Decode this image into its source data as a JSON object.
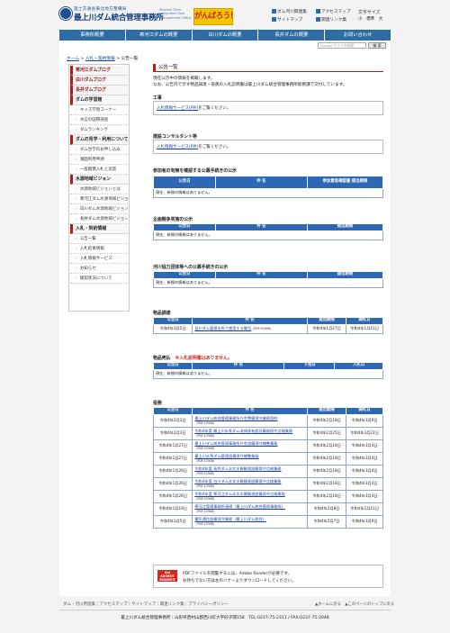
{
  "header": {
    "org_line1": "国土交通省東北地方整備局",
    "org_name": "最上川ダム統合管理事務所",
    "org_en": "Mogami River Integrated Dam Management Office",
    "banner": "がんばろう！東北",
    "links": [
      "ダム河川関連集",
      "アクセスマップ",
      "サイトマップ",
      "関連リンク集"
    ],
    "font_size_label": "文字サイズ",
    "font_sizes": [
      "小",
      "標準",
      "大"
    ]
  },
  "nav": {
    "tabs": [
      "事務所概要",
      "寒河江ダムの概要",
      "白川ダムの概要",
      "長井ダムの概要",
      "お問い合わせ"
    ],
    "search_placeholder": "Google サイト内検索",
    "search_button": "検 索"
  },
  "breadcrumb": {
    "home": "ホーム",
    "sep1": " > ",
    "section": "入札・契約情報",
    "sep2": " > ",
    "current": "公告一覧"
  },
  "sidebar": [
    {
      "type": "head",
      "label": "寒河江ダムブログ"
    },
    {
      "type": "head",
      "label": "白川ダムブログ"
    },
    {
      "type": "head",
      "label": "長井ダムブログ"
    },
    {
      "type": "head",
      "label": "ダムの学習館"
    },
    {
      "type": "item",
      "label": "キッズ学習コーナー"
    },
    {
      "type": "item",
      "label": "水辺の国際調査"
    },
    {
      "type": "item",
      "label": "ダムランキング"
    },
    {
      "type": "head",
      "label": "ダムの見学・利用について"
    },
    {
      "type": "item",
      "label": "ダム見学のお申し込み"
    },
    {
      "type": "item",
      "label": "湖面利用申請"
    },
    {
      "type": "item",
      "label": "一般無償入札と実質"
    },
    {
      "type": "head",
      "label": "水源地域ビジョン"
    },
    {
      "type": "item",
      "label": "水源地域ビジョンとは"
    },
    {
      "type": "item",
      "label": "寒河江ダム水源地域ビジョン"
    },
    {
      "type": "item",
      "label": "白川ダム水源地域ビジョン"
    },
    {
      "type": "item",
      "label": "長井ダム水源地域ビジョン"
    },
    {
      "type": "head",
      "label": "入札・契約情報"
    },
    {
      "type": "item",
      "label": "公告一覧"
    },
    {
      "type": "item",
      "label": "入札結果情報"
    },
    {
      "type": "item",
      "label": "入札情報サービス"
    },
    {
      "type": "item",
      "label": "お知らせ"
    },
    {
      "type": "item",
      "label": "随契状況について"
    }
  ],
  "content": {
    "title": "公告一覧",
    "intro1": "現在公示中の情報を掲載します。",
    "intro2": "なお、公告内で示す物品調達・役務の入札説明書は最上川ダム統合管理事務所総務課で交付しています。",
    "koji": {
      "heading": "工事",
      "link": "入札情報サービス(PPI)",
      "suffix": "をご覧ください。"
    },
    "consultant": {
      "heading": "建設コンサルタント等",
      "link": "入札情報サービス(PPI)",
      "suffix": "をご覧ください。"
    },
    "participation": {
      "heading": "参加者の有無を確認する公募手続きの公示",
      "columns": [
        "公告日",
        "件 名",
        "参加意思確認書 提出期限"
      ],
      "empty": "現在、新規の情報はありません。"
    },
    "planning": {
      "heading": "企画競争実施の公示",
      "columns": [
        "公告日",
        "件 名",
        "提出期限"
      ],
      "empty": "現在、新規の情報はありません。"
    },
    "river": {
      "heading": "河川協力団体等への公募手続きの公示",
      "columns": [
        "公告日",
        "件 名",
        "提出期限"
      ],
      "empty": "現在、新規の情報はありません。"
    },
    "goods": {
      "heading": "物品調達",
      "columns": [
        "公告日",
        "件 名",
        "提出期限",
        "開札日"
      ],
      "rows": [
        {
          "date": "令和4年1月5日",
          "title": "白川ダム管理支所で使用する電気",
          "pdf": "（PDF:109KB）",
          "deadline": "令和4年1月27日",
          "opening": "令和4年1月21日"
        }
      ]
    },
    "sales": {
      "heading": "物品売払",
      "notice": "※入札説明書はありません。",
      "columns": [
        "公告日",
        "件 名",
        "下見日",
        "入札日"
      ],
      "empty": "現在、新規の情報はありません。"
    },
    "services": {
      "heading": "役務",
      "columns": [
        "公告日",
        "件 名",
        "提出期限",
        "開札日"
      ],
      "rows": [
        {
          "date": "令和4年2月3日",
          "title": "最上川ダム統合管理事務所庁舎警備保守業務契約",
          "pdf": "（PDF:103KB）",
          "deadline": "令和4年2月18日",
          "opening": "令和4年3月9日"
        },
        {
          "date": "令和4年2月3日",
          "title": "令和4年度 最上川水系ダム流体保有設計業務保守点検業務",
          "pdf": "（PDF:103KB）",
          "deadline": "令和4年2月25日",
          "opening": "令和4年3月22日"
        },
        {
          "date": "令和4年1月27日",
          "title": "最上川ダム統合管理事務所庁舎設備保守補整業務",
          "pdf": "（PDF:103KB）",
          "deadline": "令和4年2月18日",
          "opening": "令和4年3月4日"
        },
        {
          "date": "令和4年1月27日",
          "title": "最上川水系ダム管理設備保守補整業務",
          "pdf": "（PDF:103KB）",
          "deadline": "令和4年2月18日",
          "opening": "令和4年3月4日"
        },
        {
          "date": "令和4年1月26日",
          "title": "令和4年度 長井ダム水文水質観測設備保守点検業務",
          "pdf": "（PDF:103KB）",
          "deadline": "令和4年2月18日",
          "opening": "令和4年3月4日"
        },
        {
          "date": "令和4年1月26日",
          "title": "令和4年度 白川ダム水文水質観測設備保守点検業務",
          "pdf": "（PDF:103KB）",
          "deadline": "令和4年2月18日",
          "opening": "令和4年3月4日"
        },
        {
          "date": "令和4年1月26日",
          "title": "令和4年度 寒河江ダム水文水質観測設備保守点検業務",
          "pdf": "（PDF:103KB）",
          "deadline": "令和4年2月18日",
          "opening": "令和4年3月4日"
        },
        {
          "date": "令和4年1月19日",
          "title": "寒河江管理事務所清掃（最上川ダム統合管理事務所）",
          "pdf": "（PDF:103KB）",
          "deadline": "令和4年2月8日",
          "opening": "令和4年2月21日"
        },
        {
          "date": "令和4年1月5日",
          "title": "電気通信設備保守業務（最上川ダム統合）",
          "pdf": "（PDF:103KB）",
          "deadline": "令和4年2月7日",
          "opening": "令和4年3月9日"
        }
      ]
    },
    "pdf": {
      "badge": "Get ADOBE® READER®",
      "text1": "PDFファイルを閲覧するには、Adobe Readerが必要です。",
      "text2": "お持ちでない方は左のバナーよりダウンロードしてください。"
    }
  },
  "footer": {
    "links": "ダム・河川用語集｜アクセスマップ｜サイトマップ｜関連リンク集｜プライバシーポリシー",
    "right": "▲ホームに戻る　▲このページのトップに戻る",
    "address": "最上川ダム統合管理事務所｜山形県西村山郡西川町大字砂子関158　TEL:0237-75-2311 / FAX:0237-75-2048"
  },
  "colors": {
    "nav_blue": "#2e6da4",
    "table_header": "#2d68b4",
    "accent_red": "#a8201a",
    "banner_yellow": "#f2c500"
  }
}
